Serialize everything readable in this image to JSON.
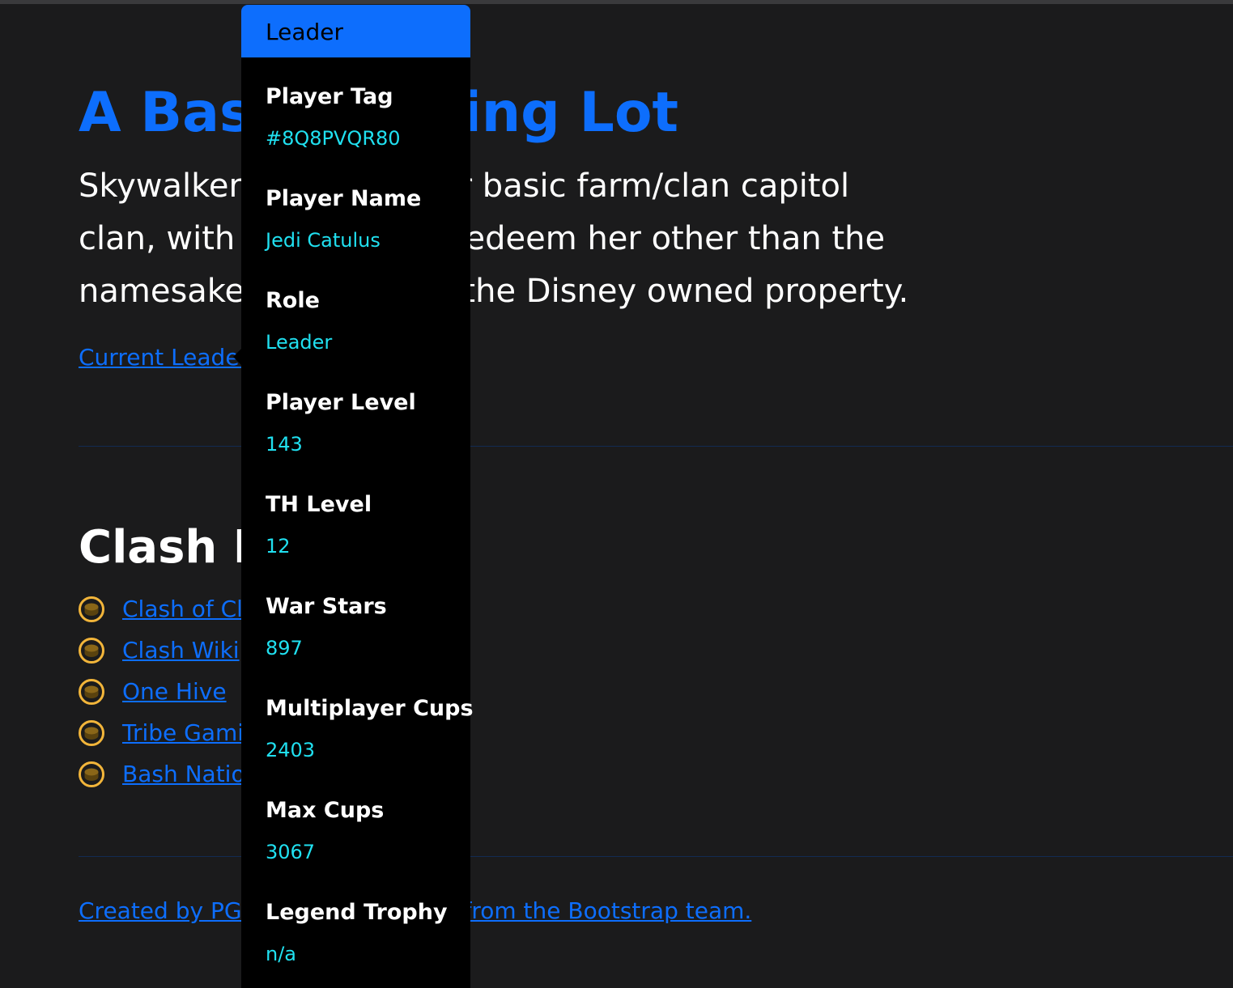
{
  "hero": {
    "title": "A Basic Parking Lot",
    "lead": "Skywalker Ranch is your basic farm/clan capitol clan, with very little to redeem her other than the namesake reference to the Disney owned property.",
    "leader_link": "Current Leader"
  },
  "links": {
    "heading": "Clash Links",
    "items": [
      {
        "label": "Clash of Clans",
        "icon": "coin-icon"
      },
      {
        "label": "Clash Wiki",
        "icon": "coin-icon"
      },
      {
        "label": "One Hive",
        "icon": "coin-icon"
      },
      {
        "label": "Tribe Gaming",
        "icon": "coin-icon"
      },
      {
        "label": "Bash Nation",
        "icon": "coin-icon"
      }
    ]
  },
  "footer": {
    "credit": "Created by PGA using a template from the Bootstrap team."
  },
  "popover": {
    "header": "Leader",
    "fields": [
      {
        "label": "Player Tag",
        "value": "#8Q8PVQR80"
      },
      {
        "label": "Player Name",
        "value": "Jedi Catulus"
      },
      {
        "label": "Role",
        "value": "Leader"
      },
      {
        "label": "Player Level",
        "value": "143"
      },
      {
        "label": "TH Level",
        "value": "12"
      },
      {
        "label": "War Stars",
        "value": "897"
      },
      {
        "label": "Multiplayer Cups",
        "value": "2403"
      },
      {
        "label": "Max Cups",
        "value": "3067"
      },
      {
        "label": "Legend Trophy",
        "value": "n/a"
      }
    ]
  },
  "colors": {
    "background": "#1b1b1c",
    "primary": "#0d6efd",
    "value_text": "#20e0f0",
    "coin_ring": "#f2b53a"
  }
}
